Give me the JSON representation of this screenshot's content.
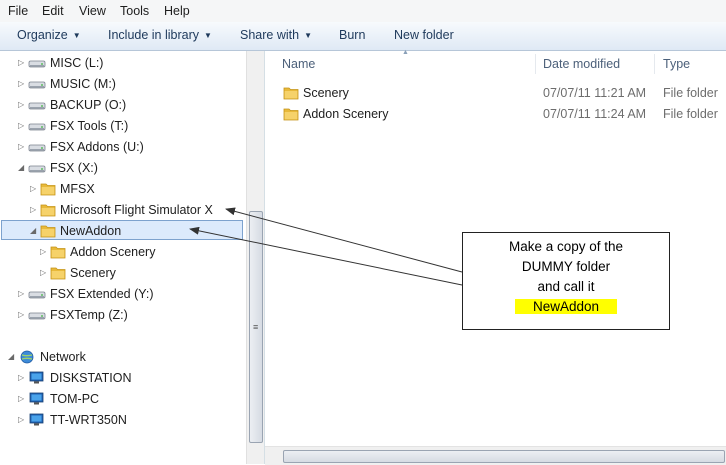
{
  "menu": [
    "File",
    "Edit",
    "View",
    "Tools",
    "Help"
  ],
  "toolbar": {
    "organize": "Organize",
    "include_in_library": "Include in library",
    "share_with": "Share with",
    "burn": "Burn",
    "new_folder": "New folder"
  },
  "tree": [
    {
      "label": "MISC (L:)",
      "icon": "drive-icon"
    },
    {
      "label": "MUSIC (M:)",
      "icon": "drive-icon"
    },
    {
      "label": "BACKUP (O:)",
      "icon": "drive-icon"
    },
    {
      "label": "FSX Tools (T:)",
      "icon": "drive-icon"
    },
    {
      "label": "FSX Addons (U:)",
      "icon": "drive-icon"
    },
    {
      "label": "FSX (X:)",
      "icon": "drive-icon"
    },
    {
      "label": "MFSX",
      "icon": "folder-icon"
    },
    {
      "label": "Microsoft Flight Simulator X",
      "icon": "folder-icon"
    },
    {
      "label": "NewAddon",
      "icon": "folder-icon",
      "selected": true
    },
    {
      "label": "Addon Scenery",
      "icon": "folder-icon"
    },
    {
      "label": "Scenery",
      "icon": "folder-icon"
    },
    {
      "label": "FSX Extended (Y:)",
      "icon": "drive-icon"
    },
    {
      "label": "FSXTemp (Z:)",
      "icon": "drive-icon"
    },
    {
      "label": "Network",
      "icon": "network-icon"
    },
    {
      "label": "DISKSTATION",
      "icon": "computer-icon"
    },
    {
      "label": "TOM-PC",
      "icon": "computer-icon"
    },
    {
      "label": "TT-WRT350N",
      "icon": "computer-icon"
    }
  ],
  "columns": {
    "name": "Name",
    "date_modified": "Date modified",
    "type": "Type"
  },
  "files": [
    {
      "name": "Scenery",
      "date": "07/07/11 11:21 AM",
      "type": "File folder"
    },
    {
      "name": "Addon Scenery",
      "date": "07/07/11 11:24 AM",
      "type": "File folder"
    }
  ],
  "callout": {
    "line1": "Make a copy of the",
    "line2": "DUMMY folder",
    "line3": "and call it",
    "highlight": "NewAddon"
  },
  "colors": {
    "highlight": "#ffff00",
    "selection": "#dceafc",
    "toolbar_text": "#1e395b"
  }
}
